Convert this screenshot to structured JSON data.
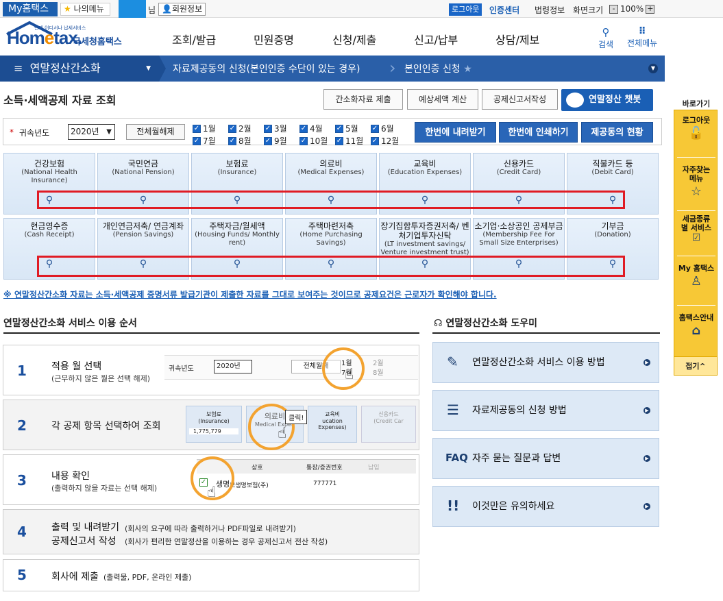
{
  "topbar": {
    "my_hometax": "My홈택스",
    "my_menu": "나의메뉴",
    "name_suffix": "님",
    "member_info": "회원정보",
    "logout": "로그아웃",
    "cert_center": "인증센터",
    "law_info": "법령정보",
    "screen_size": "화면크기",
    "zoom": "100%",
    "minus": "-",
    "plus": "+"
  },
  "logo": {
    "main_a": "Hom",
    "main_e": "e",
    "main_b": "tax.",
    "korean": "국세청홈택스",
    "small": "언제 어디서나 납세서비스"
  },
  "gnav": [
    "조회/발급",
    "민원증명",
    "신청/제출",
    "신고/납부",
    "상담/제보"
  ],
  "search_label": "검색",
  "all_menu_label": "전체메뉴",
  "breadcrumb": {
    "level1": "연말정산간소화",
    "level2": "자료제공동의 신청(본인인증 수단이 있는 경우)",
    "level3": "본인인증 신청"
  },
  "page_title": "소득·세액공제 자료 조회",
  "top_buttons": {
    "simple_submit": "간소화자료 제출",
    "tax_estimate": "예상세액 계산",
    "deduction_form": "공제신고서작성",
    "chatbot": "연말정산 챗봇"
  },
  "filter": {
    "label": "귀속년도",
    "year": "2020년",
    "clear_all": "전체월해제",
    "months": [
      "1월",
      "2월",
      "3월",
      "4월",
      "5월",
      "6월",
      "7월",
      "8월",
      "9월",
      "10월",
      "11월",
      "12월"
    ],
    "download_all": "한번에 내려받기",
    "print_all": "한번에 인쇄하기",
    "consent_status": "제공동의 현황"
  },
  "cards_row1": [
    {
      "t": "건강보험",
      "e": "(National Health Insurance)"
    },
    {
      "t": "국민연금",
      "e": "(National Pension)"
    },
    {
      "t": "보험료",
      "e": "(Insurance)"
    },
    {
      "t": "의료비",
      "e": "(Medical Expenses)"
    },
    {
      "t": "교육비",
      "e": "(Education Expenses)"
    },
    {
      "t": "신용카드",
      "e": "(Credit Card)"
    },
    {
      "t": "직불카드 등",
      "e": "(Debit Card)"
    }
  ],
  "cards_row2": [
    {
      "t": "현금영수증",
      "e": "(Cash Receipt)"
    },
    {
      "t": "개인연금저축/ 연금계좌",
      "e": "(Pension Savings)"
    },
    {
      "t": "주택자금/월세액",
      "e": "(Housing Funds/ Monthly rent)"
    },
    {
      "t": "주택마련저축",
      "e": "(Home Purchasing Savings)"
    },
    {
      "t": "장기집합투자증권저축/ 벤처기업투자신탁",
      "e": "(LT investment savings/ Venture investment trust)"
    },
    {
      "t": "소기업·소상공인 공제부금",
      "e": "(Membership Fee For Small Size Enterprises)"
    },
    {
      "t": "기부금",
      "e": "(Donation)"
    }
  ],
  "notice": "※ 연말정산간소화 자료는 소득·세액공제 증명서류 발급기관이 제출한 자료를 그대로 보여주는 것이므로 공제요건은 근로자가 확인해야 합니다.",
  "steps_title": "연말정산간소화 서비스 이용 순서",
  "steps": [
    {
      "n": "1",
      "t": "적용 월 선택",
      "s": "(근무하지 않은 월은 선택 해제)"
    },
    {
      "n": "2",
      "t": "각 공제 항목 선택하여 조회",
      "s": ""
    },
    {
      "n": "3",
      "t": "내용 확인",
      "s": "(출력하지 않을 자료는 선택 해제)"
    },
    {
      "n": "4",
      "t": "출력 및 내려받기",
      "t2": "공제신고서 작성",
      "s": "(회사의 요구에 따라 출력하거나 PDF파일로 내려받기)",
      "s2": "(회사가 편리한 연말정산을 이용하는 경우 공제신고서 전산 작성)"
    },
    {
      "n": "5",
      "t": "회사에 제출",
      "s": "(출력물, PDF, 온라인 제출)"
    }
  ],
  "step_illus": {
    "s1_label": "귀속년도",
    "s1_year": "2020년",
    "s1_clear": "전체월해",
    "s1_m1": "1월",
    "s1_m7": "7월",
    "s1_m2": "2월",
    "s1_m8": "8월",
    "s2_ins": "보험료",
    "s2_ins_e": "(Insurance)",
    "s2_amount": "1,775,779",
    "s2_med": "의료비",
    "s2_med_e": "Medical Expen",
    "s2_click": "클릭!",
    "s2_edu": "교육비",
    "s2_edu_e": "ucation Expenses)",
    "s2_cc": "신용카드",
    "s2_cc_e": "(Credit Car",
    "s3_col1": "상호",
    "s3_col2": "통장/증권번호",
    "s3_col3": "납입",
    "s3_row": "보생명보험(주)",
    "s3_num": "777771",
    "s3_life": "생명"
  },
  "help_title": "연말정산간소화 도우미",
  "help": [
    {
      "ic": "✎",
      "t": "연말정산간소화 서비스 이용 방법"
    },
    {
      "ic": "☰",
      "t": "자료제공동의 신청 방법"
    },
    {
      "ic": "FAQ",
      "t": "자주 묻는 질문과 답변"
    },
    {
      "ic": "!!",
      "t": "이것만은 유의하세요"
    }
  ],
  "quick": {
    "title": "바로가기",
    "items": [
      {
        "t": "로그아웃",
        "ic": "🔓"
      },
      {
        "t": "자주찾는 메뉴",
        "ic": "☆"
      },
      {
        "t": "세금종류별 서비스",
        "ic": "☑"
      },
      {
        "t": "My 홈택스",
        "ic": "♙"
      },
      {
        "t": "홈택스안내",
        "ic": "⌂"
      }
    ],
    "fold": "접기^"
  }
}
